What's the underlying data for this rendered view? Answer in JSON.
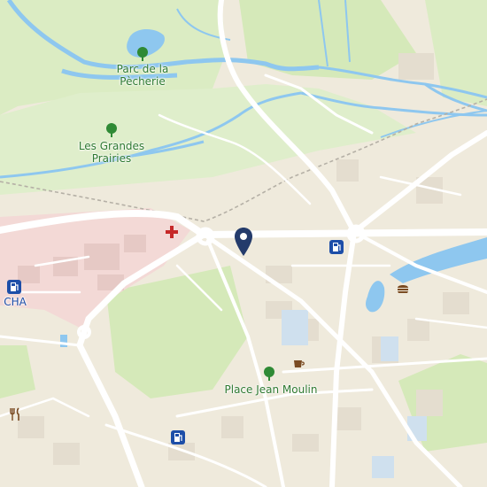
{
  "map": {
    "labels": {
      "parc": [
        "Parc de la",
        "Pècherie"
      ],
      "prairies": [
        "Les Grandes",
        "Prairies"
      ],
      "place": "Place Jean Moulin",
      "cha": "CHA"
    },
    "icons": {
      "pin": "location-pin-icon",
      "hospital": "hospital-cross-icon",
      "fuel": "fuel-station-icon",
      "cafe": "cafe-icon",
      "fast_food": "fast-food-icon",
      "restaurant": "restaurant-icon",
      "park": "park-tree-icon"
    },
    "colors": {
      "land": "#efeadc",
      "park": "#d5e9b9",
      "water": "#8ec7ef",
      "hospital": "#f3d9d6",
      "road": "#ffffff",
      "pin": "#243b6b",
      "label_green": "#2f7a32",
      "label_blue": "#1d4ea8"
    }
  }
}
